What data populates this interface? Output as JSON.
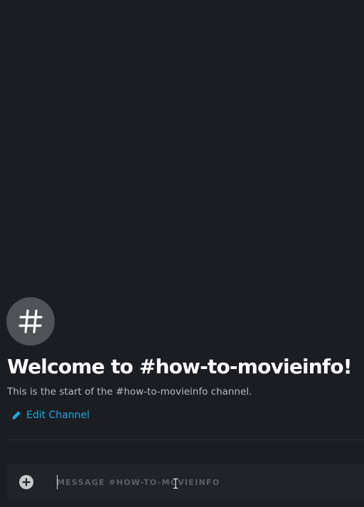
{
  "channel": {
    "icon": "hashtag-icon",
    "welcome_title": "Welcome to #how-to-movieinfo!",
    "welcome_subtitle": "This is the start of the #how-to-movieinfo channel.",
    "edit_label": "Edit Channel",
    "edit_icon": "pencil-icon"
  },
  "composer": {
    "attach_icon": "plus-circle-icon",
    "placeholder": "MESSAGE #HOW-TO-MOVIEINFO",
    "value": ""
  },
  "colors": {
    "background": "#1b1d22",
    "composer_background": "#202328",
    "link": "#22a7e0",
    "icon_circle": "#4f5257"
  }
}
